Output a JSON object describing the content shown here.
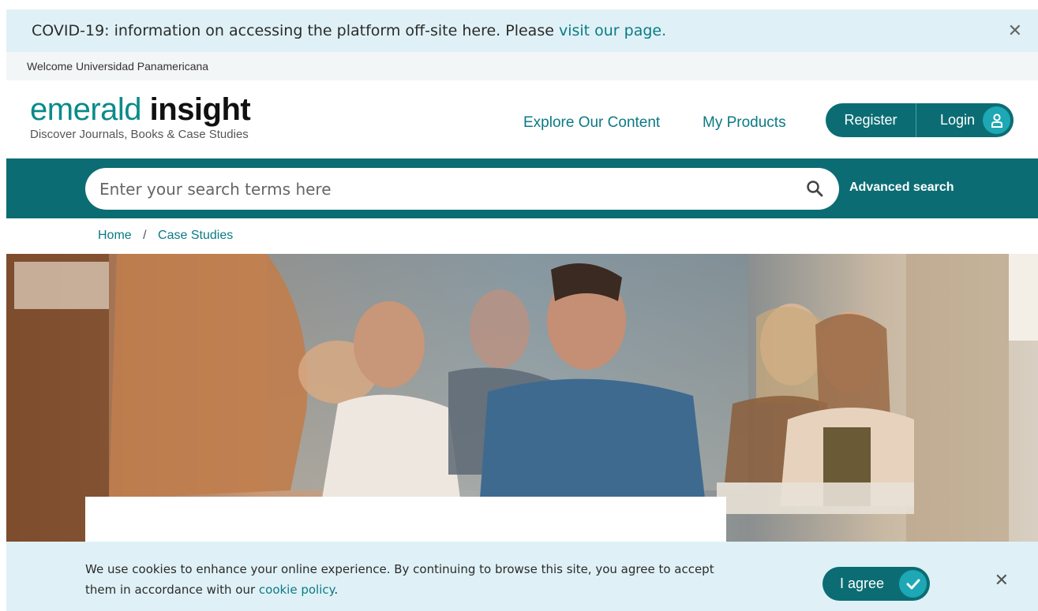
{
  "covid_banner": {
    "text": "COVID-19: information on accessing the platform off-site here. Please ",
    "link_text": "visit our page.",
    "close_glyph": "✕"
  },
  "welcome": {
    "text": "Welcome Universidad Panamericana"
  },
  "logo": {
    "brand_light": "emerald",
    "brand_bold": "insight",
    "tagline": "Discover Journals, Books & Case Studies"
  },
  "nav": {
    "explore": "Explore Our Content",
    "products": "My Products"
  },
  "auth": {
    "register": "Register",
    "login": "Login",
    "user_icon": "user-icon"
  },
  "search": {
    "placeholder": "Enter your search terms here",
    "icon": "search-icon",
    "advanced": "Advanced search"
  },
  "breadcrumb": {
    "items": [
      "Home",
      "Case Studies"
    ],
    "separator": "/"
  },
  "hero": {
    "image": "classroom-photo"
  },
  "cookie_banner": {
    "text": "We use cookies to enhance your online experience. By continuing to browse this site, you agree to accept them in accordance with our ",
    "link_text": "cookie policy",
    "suffix": ".",
    "agree": "I agree",
    "agree_icon": "check-icon",
    "close_glyph": "✕"
  },
  "colors": {
    "brand_teal": "#0b6d73",
    "accent_teal": "#1ea7b4",
    "link_teal": "#0b7a85",
    "banner_bg": "#dff1f6"
  }
}
